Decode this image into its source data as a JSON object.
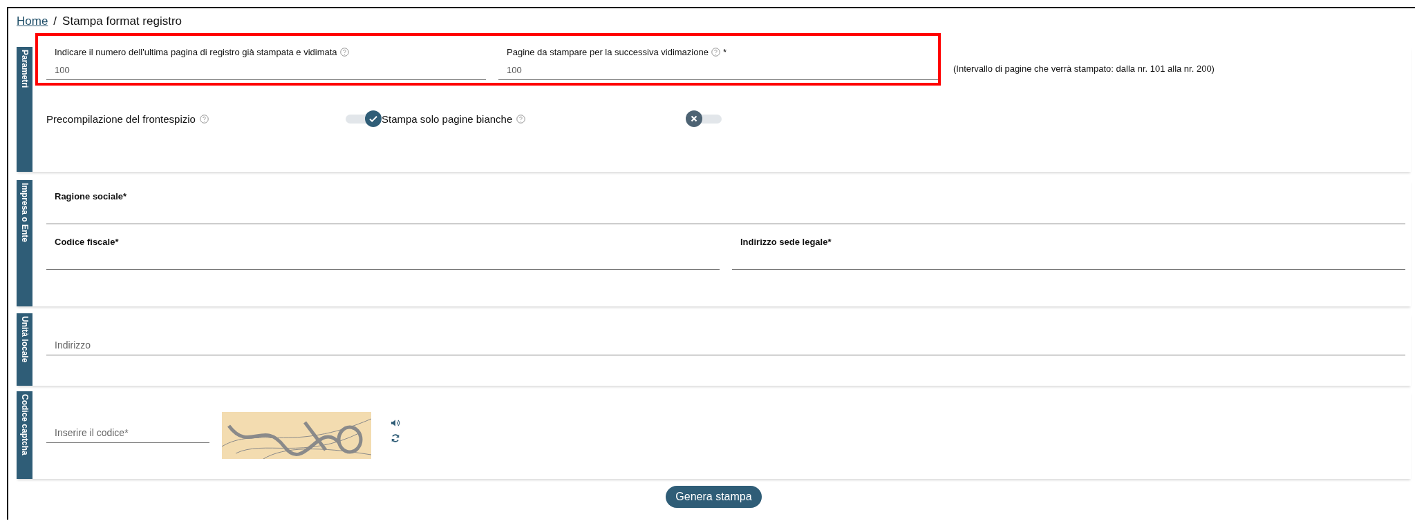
{
  "breadcrumb": {
    "items": [
      {
        "label": "Home",
        "kind": "link"
      },
      {
        "label": "Stampa format registro",
        "kind": "current"
      }
    ],
    "separator": "/"
  },
  "parameters": {
    "label": "Parametri",
    "highlighted": true,
    "fields": [
      {
        "label": "Indicare il numero dell'ultima pagina di registro già stampata e vidimata",
        "help": true,
        "value": "100"
      },
      {
        "label": "Pagine da stampare per la successiva vidimazione",
        "help": true,
        "mark": "*",
        "value": "100"
      }
    ],
    "note": "(Intervallo di pagine che verrà stampato: dalla nr. 101 alla nr. 200)",
    "toggles": [
      {
        "label": "Precompilazione del frontespizio",
        "help": true,
        "on": true
      },
      {
        "label": "Stampa solo pagine bianche",
        "help": true,
        "on": false
      }
    ]
  },
  "company": {
    "label": "Impresa o Ente",
    "rows": [
      [
        {
          "label": "Ragione sociale*"
        }
      ],
      [
        {
          "label": "Codice fiscale*"
        },
        {
          "label": "Indirizzo sede legale*"
        }
      ]
    ]
  },
  "local_unit": {
    "label": "Unità locale",
    "field": {
      "placeholder": "Indirizzo"
    }
  },
  "captcha": {
    "label": "Codice captcha",
    "field": {
      "placeholder": "Inserire il codice*"
    }
  },
  "submit": {
    "label": "Genera stampa"
  }
}
